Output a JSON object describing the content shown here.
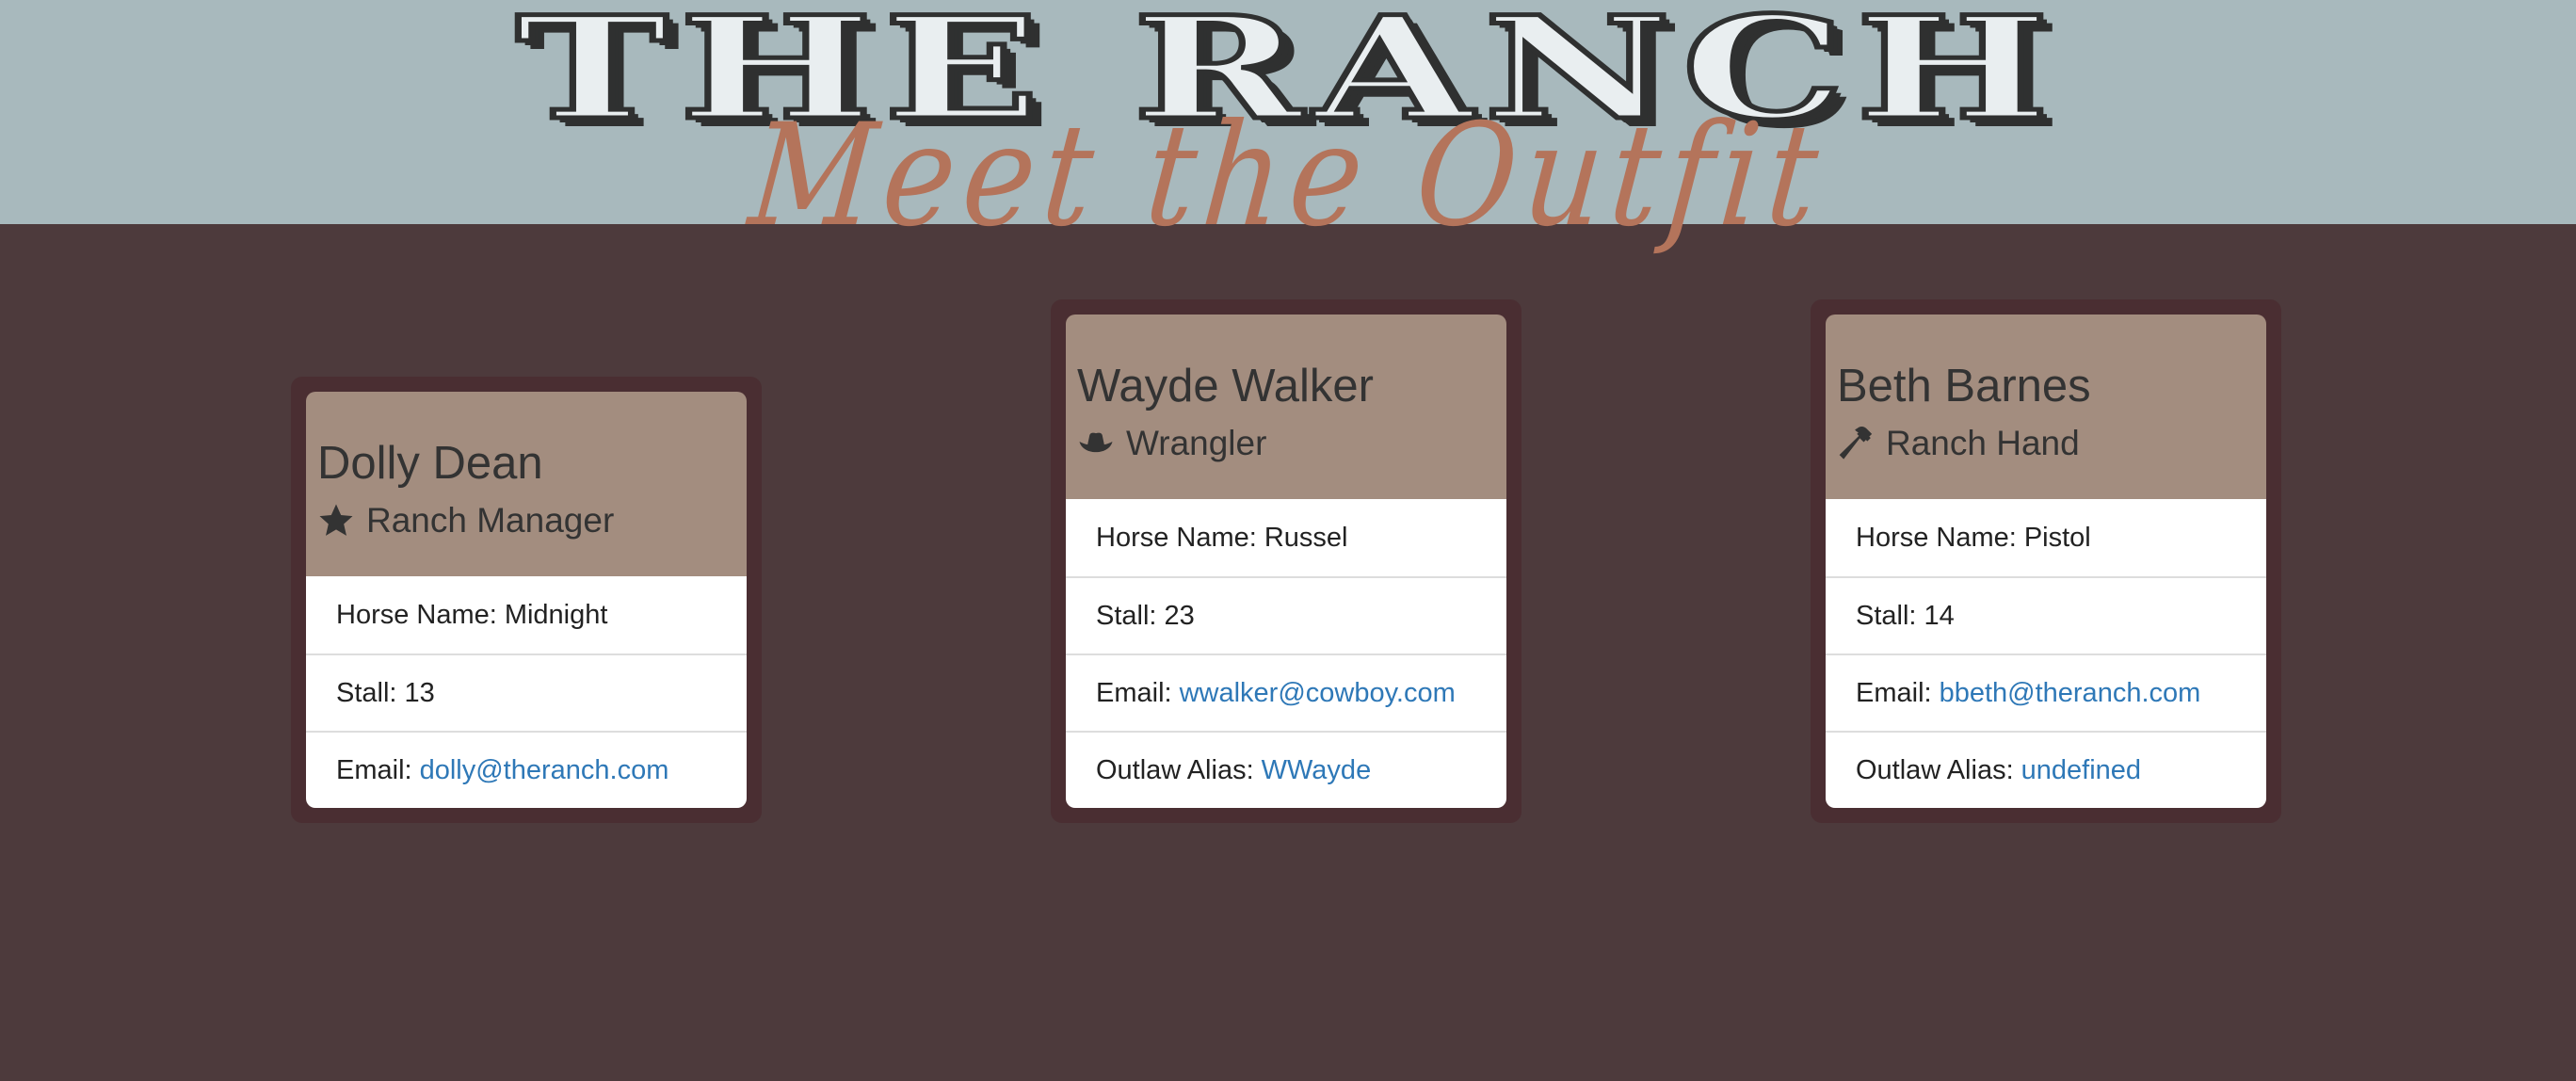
{
  "header": {
    "title": "THE RANCH",
    "subtitle": "Meet the Outfit"
  },
  "colors": {
    "header_bg": "#a8b9bd",
    "page_bg": "#4d3a3c",
    "card_border": "#4a2e32",
    "card_header": "#a38d7f",
    "subtitle": "#b4745b",
    "link": "#2e78b7"
  },
  "cards": [
    {
      "name": "Dolly Dean",
      "role": "Ranch Manager",
      "role_icon": "star-icon",
      "horse_label": "Horse Name:",
      "horse": "Midnight",
      "stall_label": "Stall:",
      "stall": "13",
      "email_label": "Email:",
      "email": "dolly@theranch.com"
    },
    {
      "name": "Wayde Walker",
      "role": "Wrangler",
      "role_icon": "cowboy-hat-icon",
      "horse_label": "Horse Name:",
      "horse": "Russel",
      "stall_label": "Stall:",
      "stall": "23",
      "email_label": "Email:",
      "email": "wwalker@cowboy.com",
      "alias_label": "Outlaw Alias:",
      "alias": "WWayde"
    },
    {
      "name": "Beth Barnes",
      "role": "Ranch Hand",
      "role_icon": "hammer-icon",
      "horse_label": "Horse Name:",
      "horse": "Pistol",
      "stall_label": "Stall:",
      "stall": "14",
      "email_label": "Email:",
      "email": "bbeth@theranch.com",
      "alias_label": "Outlaw Alias:",
      "alias": "undefined"
    }
  ]
}
